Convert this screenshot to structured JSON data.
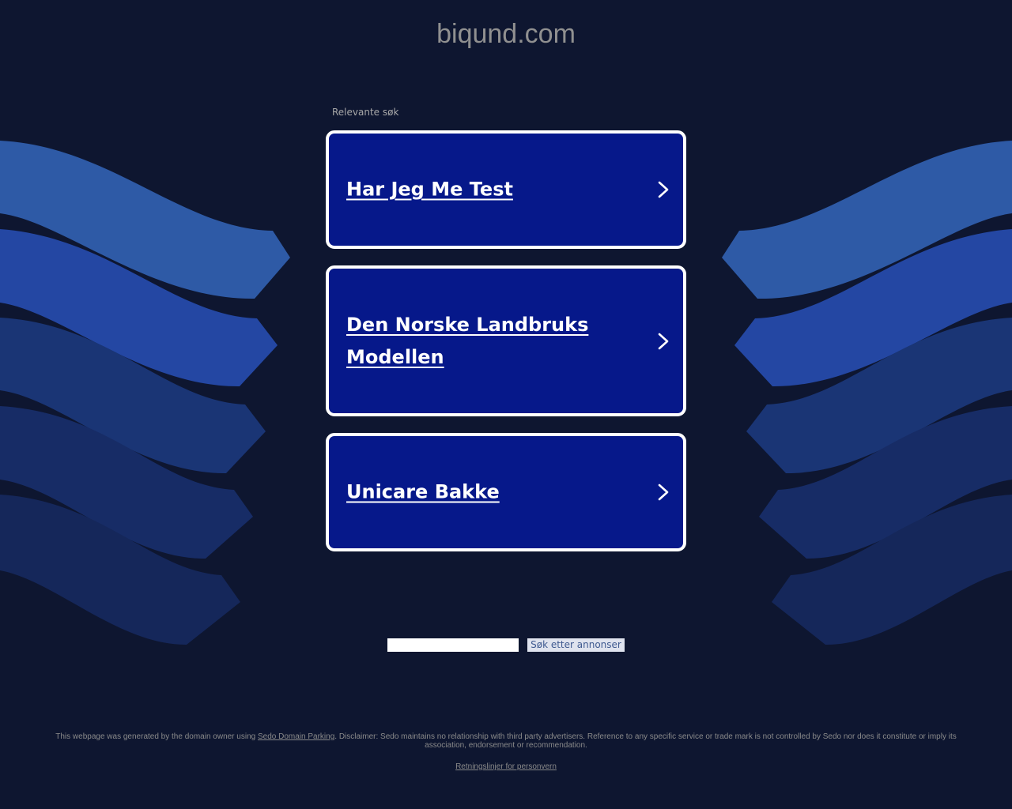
{
  "header": {
    "domain": "biqund.com"
  },
  "related": {
    "label": "Relevante søk",
    "links": [
      {
        "text": "Har Jeg Me Test"
      },
      {
        "text": "Den Norske Landbruks Modellen"
      },
      {
        "text": "Unicare Bakke"
      }
    ]
  },
  "search": {
    "input_value": "",
    "button_label": "Søk etter annonser"
  },
  "footer": {
    "disclaimer_before": "This webpage was generated by the domain owner using ",
    "sedo_link": "Sedo Domain Parking",
    "disclaimer_after": ". Disclaimer: Sedo maintains no relationship with third party advertisers. Reference to any specific service or trade mark is not controlled by Sedo nor does it constitute or imply its association, endorsement or recommendation.",
    "privacy_link": "Retningslinjer for personvern"
  },
  "icons": {
    "card_arrow": "chevron-right-icon"
  },
  "colors": {
    "background": "#0e1630",
    "card_fill": "#06188a",
    "card_border": "#ffffff",
    "wing_light": "#2e5aa6",
    "wing_mid": "#2447a3",
    "wing_dark": "#1a2f6e"
  }
}
